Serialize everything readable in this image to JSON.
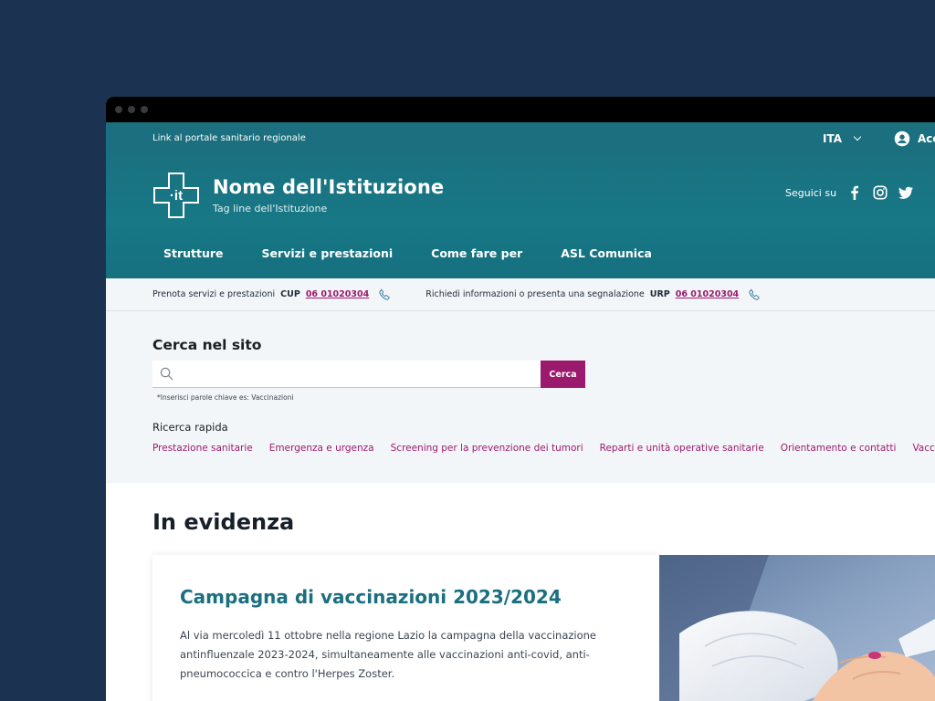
{
  "slim_header": {
    "link_label": "Link al portale sanitario regionale",
    "language": "ITA",
    "access_label": "Accedi"
  },
  "brand": {
    "logo_text": "·it",
    "title": "Nome dell'Istituzione",
    "tagline": "Tag line dell'Istituzione"
  },
  "social": {
    "label": "Seguici su",
    "icons": [
      "facebook-icon",
      "instagram-icon",
      "twitter-icon"
    ]
  },
  "nav": {
    "items": [
      "Strutture",
      "Servizi e prestazioni",
      "Come fare per",
      "ASL Comunica"
    ]
  },
  "contacts": {
    "cup_text": "Prenota servizi e prestazioni",
    "cup_label": "CUP",
    "cup_number": "06 01020304",
    "urp_text": "Richiedi informazioni o presenta una segnalazione",
    "urp_label": "URP",
    "urp_number": "06 01020304"
  },
  "search": {
    "title": "Cerca nel sito",
    "value": "",
    "button": "Cerca",
    "hint": "*Inserisci parole chiave es: Vaccinazioni",
    "quick_title": "Ricerca rapida",
    "quick_links": [
      "Prestazione sanitarie",
      "Emergenza e urgenza",
      "Screening per la prevenzione dei tumori",
      "Reparti e unità operative sanitarie",
      "Orientamento e contatti",
      "Vaccinazioni"
    ]
  },
  "highlight": {
    "section_title": "In evidenza",
    "card_title": "Campagna di vaccinazioni 2023/2024",
    "card_text": "Al via mercoledì 11 ottobre nella regione Lazio la campagna della vaccinazione antinfluenzale 2023-2024, simultaneamente alle vaccinazioni anti-covid, anti-pneumococcica e contro l'Herpes Zoster."
  },
  "colors": {
    "page_bg": "#1b3350",
    "header_teal": "#187886",
    "accent_magenta": "#9b1a6d",
    "title_teal": "#1a6f80"
  }
}
